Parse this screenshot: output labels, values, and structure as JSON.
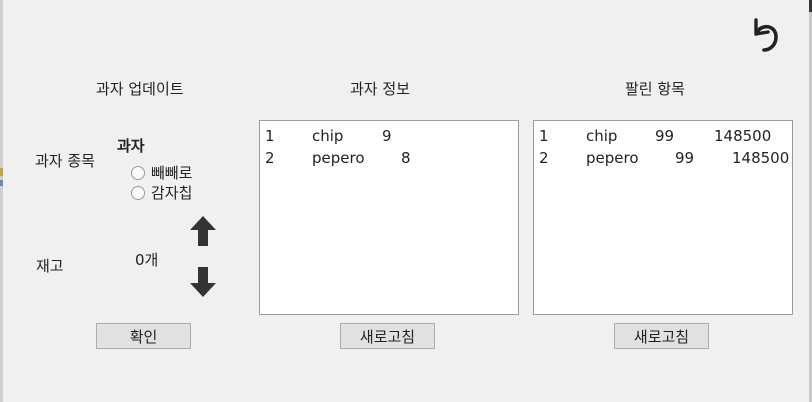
{
  "update_panel": {
    "title": "과자 업데이트",
    "category_label": "과자 종목",
    "group_label": "과자",
    "options": [
      {
        "label": "빼빼로"
      },
      {
        "label": "감자칩"
      }
    ],
    "stock_label": "재고",
    "stock_value": "0개",
    "confirm_button": "확인",
    "up_icon": "arrow-up-icon",
    "down_icon": "arrow-down-icon"
  },
  "info_panel": {
    "title": "과자 정보",
    "rows": [
      {
        "no": "1",
        "name": "chip",
        "qty": "9"
      },
      {
        "no": "2",
        "name": "pepero",
        "qty": "8"
      }
    ],
    "refresh_button": "새로고침"
  },
  "sold_panel": {
    "title": "팔린 항목",
    "rows": [
      {
        "no": "1",
        "name": "chip",
        "qty": "99",
        "amount": "148500"
      },
      {
        "no": "2",
        "name": "pepero",
        "qty": "99",
        "amount": "148500"
      }
    ],
    "refresh_button": "새로고침"
  },
  "toolbar": {
    "undo_icon": "undo-icon"
  }
}
